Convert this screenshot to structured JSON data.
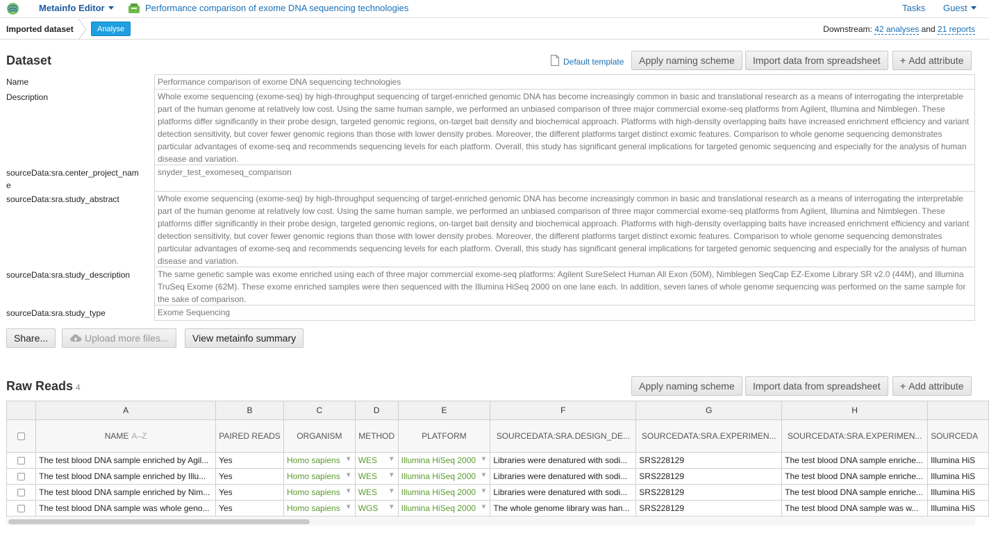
{
  "topbar": {
    "app_name": "Metainfo Editor",
    "project_title": "Performance comparison of exome DNA sequencing technologies",
    "tasks": "Tasks",
    "user": "Guest"
  },
  "breadcrumb": {
    "imported": "Imported dataset",
    "analyse": "Analyse",
    "downstream_prefix": "Downstream:",
    "analyses": "42 analyses",
    "and": "and",
    "reports": "21 reports"
  },
  "dataset": {
    "heading": "Dataset",
    "default_template": "Default template",
    "apply_naming": "Apply naming scheme",
    "import_spreadsheet": "Import data from spreadsheet",
    "add_attribute": "Add attribute",
    "attributes": [
      {
        "label": "Name",
        "value": "Performance comparison of exome DNA sequencing technologies"
      },
      {
        "label": "Description",
        "value": "Whole exome sequencing (exome-seq) by high-throughput sequencing of target-enriched genomic DNA has become increasingly common in basic and translational research as a means of interrogating the interpretable part of the human genome at relatively low cost. Using the same human sample, we performed an unbiased comparison of three major commercial exome-seq platforms from Agilent, Illumina and Nimblegen. These platforms differ significantly in their probe design, targeted genomic regions, on-target bait density and biochemical approach. Platforms with high-density overlapping baits have increased enrichment efficiency and variant detection sensitivity, but cover fewer genomic regions than those with lower density probes. Moreover, the different platforms target distinct exomic features. Comparison to whole genome sequencing demonstrates particular advantages of exome-seq and recommends sequencing levels for each platform. Overall, this study has significant general implications for targeted genomic sequencing and especially for the analysis of human disease and variation."
      },
      {
        "label": "sourceData:sra.center_project_name",
        "value": "snyder_test_exomeseq_comparison"
      },
      {
        "label": "sourceData:sra.study_abstract",
        "value": "Whole exome sequencing (exome-seq) by high-throughput sequencing of target-enriched genomic DNA has become increasingly common in basic and translational research as a means of interrogating the interpretable part of the human genome at relatively low cost. Using the same human sample, we performed an unbiased comparison of three major commercial exome-seq platforms from Agilent, Illumina and Nimblegen. These platforms differ significantly in their probe design, targeted genomic regions, on-target bait density and biochemical approach. Platforms with high-density overlapping baits have increased enrichment efficiency and variant detection sensitivity, but cover fewer genomic regions than those with lower density probes. Moreover, the different platforms target distinct exomic features. Comparison to whole genome sequencing demonstrates particular advantages of exome-seq and recommends sequencing levels for each platform. Overall, this study has significant general implications for targeted genomic sequencing and especially for the analysis of human disease and variation."
      },
      {
        "label": "sourceData:sra.study_description",
        "value": "The same genetic sample was exome enriched using each of three major commercial exome-seq platforms: Agilent SureSelect Human All Exon (50M), Nimblegen SeqCap EZ-Exome Library SR v2.0 (44M), and Illumina TruSeq Exome (62M). These exome enriched samples were then sequenced with the Illumina HiSeq 2000 on one lane each. In addition, seven lanes of whole genome sequencing was performed on the same sample for the sake of comparison."
      },
      {
        "label": "sourceData:sra.study_type",
        "value": "Exome Sequencing"
      }
    ],
    "share": "Share...",
    "upload": "Upload more files...",
    "view_summary": "View metainfo summary"
  },
  "raw_reads": {
    "heading": "Raw Reads",
    "count": "4",
    "apply_naming": "Apply naming scheme",
    "import_spreadsheet": "Import data from spreadsheet",
    "add_attribute": "Add attribute",
    "column_letters": [
      "A",
      "B",
      "C",
      "D",
      "E",
      "F",
      "G",
      "H",
      ""
    ],
    "column_headers": [
      "NAME",
      "PAIRED READS",
      "ORGANISM",
      "METHOD",
      "PLATFORM",
      "SOURCEDATA:SRA.DESIGN_DE...",
      "SOURCEDATA:SRA.EXPERIMEN...",
      "SOURCEDATA:SRA.EXPERIMEN...",
      "SOURCEDA"
    ],
    "name_sort_hint": "A–Z",
    "rows": [
      [
        "The test blood DNA sample enriched by Agil...",
        "Yes",
        "Homo sapiens",
        "WES",
        "Illumina HiSeq 2000",
        "Libraries were denatured with sodi...",
        "SRS228129",
        "The test blood DNA sample enriche...",
        "Illumina HiS"
      ],
      [
        "The test blood DNA sample enriched by Illu...",
        "Yes",
        "Homo sapiens",
        "WES",
        "Illumina HiSeq 2000",
        "Libraries were denatured with sodi...",
        "SRS228129",
        "The test blood DNA sample enriche...",
        "Illumina HiS"
      ],
      [
        "The test blood DNA sample enriched by Nim...",
        "Yes",
        "Homo sapiens",
        "WES",
        "Illumina HiSeq 2000",
        "Libraries were denatured with sodi...",
        "SRS228129",
        "The test blood DNA sample enriche...",
        "Illumina HiS"
      ],
      [
        "The test blood DNA sample was whole geno...",
        "Yes",
        "Homo sapiens",
        "WGS",
        "Illumina HiSeq 2000",
        "The whole genome library was han...",
        "SRS228129",
        "The test blood DNA sample was w...",
        "Illumina HiS"
      ]
    ]
  },
  "colors": {
    "link": "#1a6fb5",
    "analyse_badge": "#1f9fe0",
    "dropdown_green": "#5a9a2e"
  }
}
